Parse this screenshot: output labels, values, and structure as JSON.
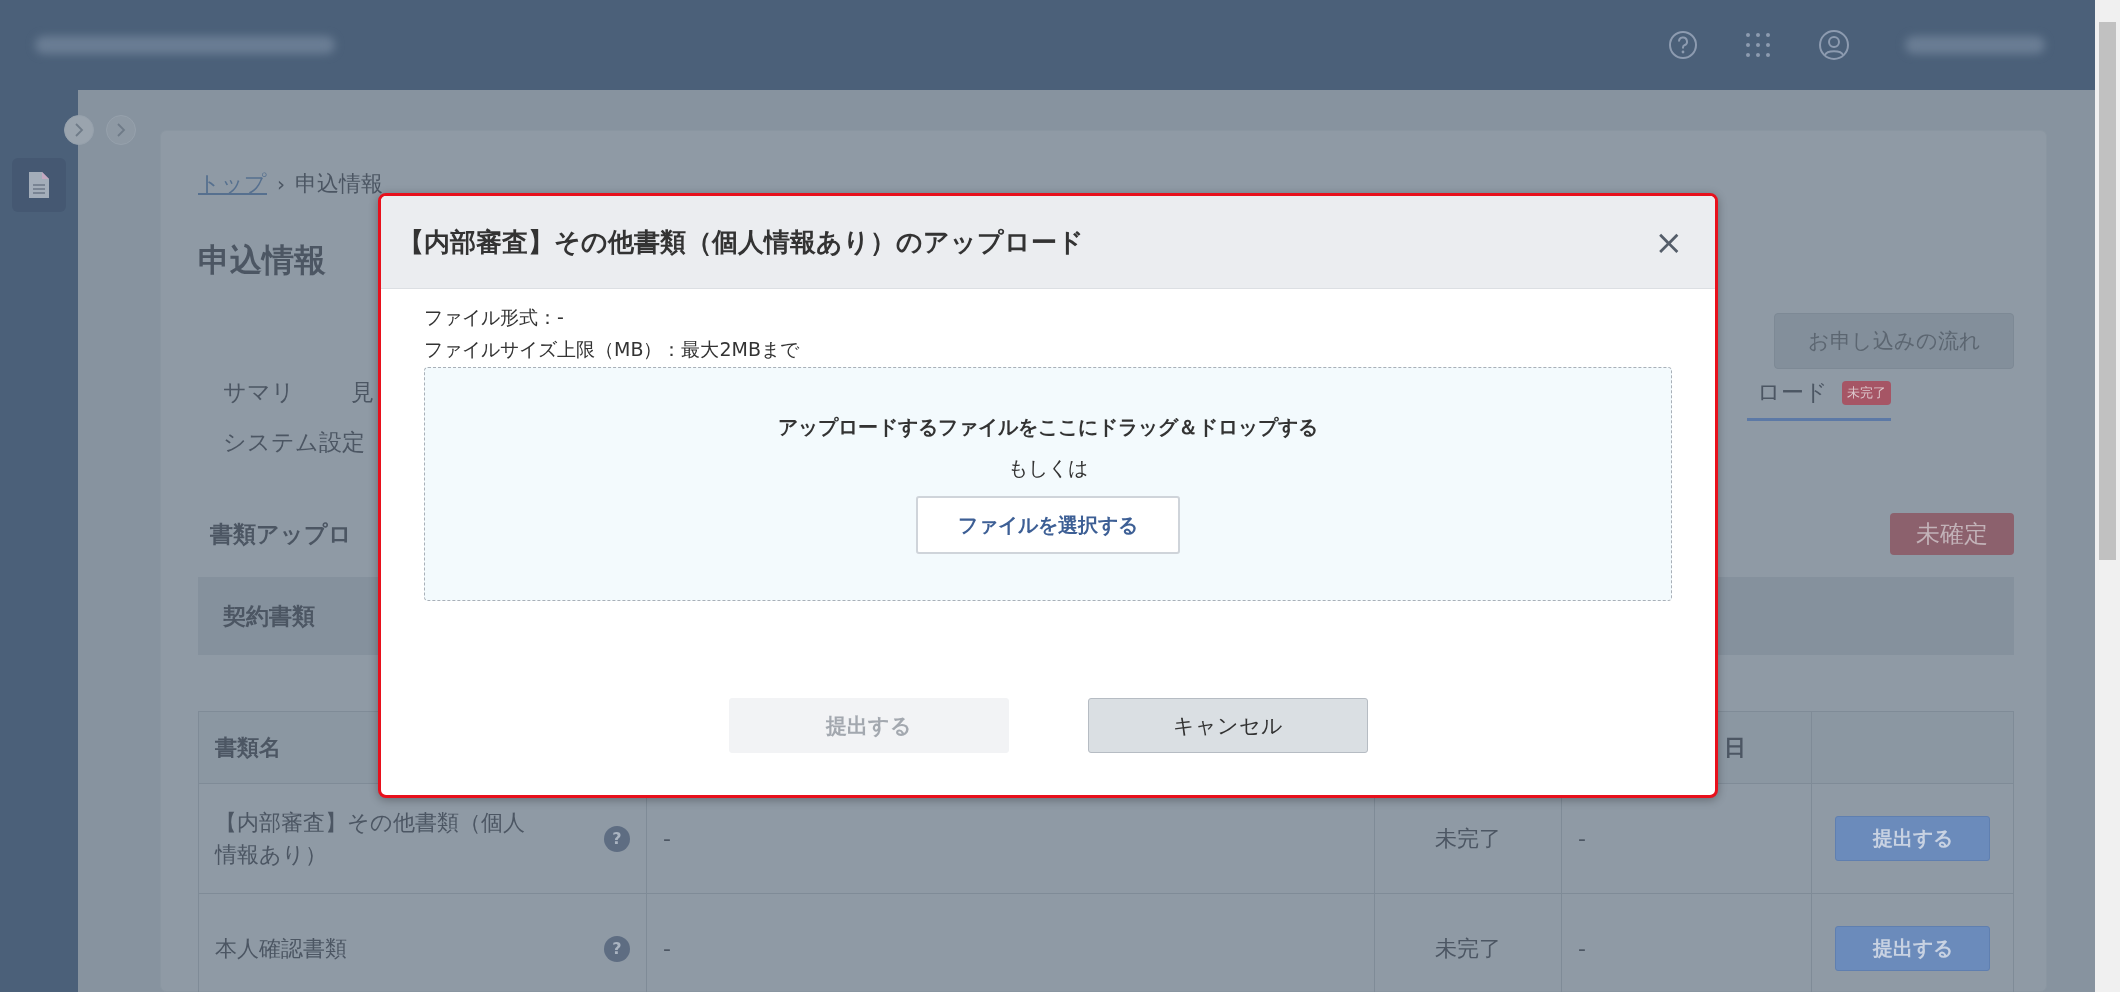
{
  "breadcrumb": [
    {
      "label": "トップ",
      "link": true
    },
    {
      "label": "申込情報",
      "link": false
    }
  ],
  "breadcrumb_separator": "›",
  "page_title": "申込情報",
  "flow_button": "お申し込みの流れ",
  "tab_rows": [
    {
      "tabs": [
        {
          "label": "サマリ",
          "selected": false
        },
        {
          "label": "見",
          "selected": false
        },
        {
          "label": "ロード",
          "selected": true,
          "badge": "未完了"
        }
      ]
    },
    {
      "tabs": [
        {
          "label": "システム設定",
          "selected": false
        }
      ]
    }
  ],
  "section_title": "書類アップロ",
  "section_status": "未確定",
  "category": "契約書類",
  "table": {
    "header": {
      "column_1": "書類名",
      "column_4": "日"
    },
    "rows": [
      {
        "name": "【内部審査】その他書類（個人情報あり）",
        "help": "?",
        "column_2": "-",
        "status": "未完了",
        "column_4": "-",
        "action": "提出する"
      },
      {
        "name": "本人確認書類",
        "help": "?",
        "column_2": "-",
        "status": "未完了",
        "column_4": "-",
        "action": "提出する"
      }
    ]
  },
  "modal": {
    "title": "【内部審査】その他書類（個人情報あり）のアップロード",
    "close": "×",
    "info": [
      "ファイル形式：-",
      "ファイルサイズ上限（MB）：最大2MBまで"
    ],
    "dropzone": {
      "prompt": "アップロードするファイルをここにドラッグ＆ドロップする",
      "or": "もしくは",
      "select_button": "ファイルを選択する"
    },
    "buttons": [
      {
        "label": "提出する",
        "disabled": true
      },
      {
        "label": "キャンセル",
        "disabled": false
      }
    ]
  }
}
